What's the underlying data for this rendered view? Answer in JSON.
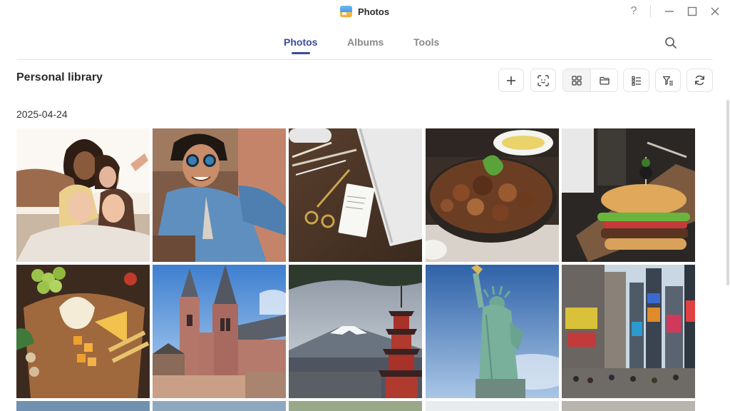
{
  "window": {
    "title": "Photos",
    "controls": [
      "help-icon",
      "minimize-icon",
      "maximize-icon",
      "close-icon"
    ],
    "help_label": "?"
  },
  "tabs": [
    {
      "label": "Photos",
      "active": true
    },
    {
      "label": "Albums",
      "active": false
    },
    {
      "label": "Tools",
      "active": false
    }
  ],
  "header": {
    "title": "Personal library",
    "toolbar": [
      "plus-icon",
      "face-scan-icon",
      "grid-view-icon",
      "folder-view-icon",
      "list-options-icon",
      "filter-icon",
      "refresh-icon"
    ]
  },
  "section": {
    "date": "2025-04-24"
  },
  "photos": [
    {
      "subject": "friends-selfie",
      "icon": "photo-group-selfie"
    },
    {
      "subject": "man-sunglasses-selfie",
      "icon": "photo-man-selfie"
    },
    {
      "subject": "desk-scissors-notes",
      "icon": "photo-desk"
    },
    {
      "subject": "stir-fried-meat-dish",
      "icon": "photo-food-plate"
    },
    {
      "subject": "hamburger",
      "icon": "photo-burger"
    },
    {
      "subject": "cheese-board",
      "icon": "photo-cheese-board"
    },
    {
      "subject": "gothic-cathedral",
      "icon": "photo-cathedral"
    },
    {
      "subject": "mount-fuji-pagoda",
      "icon": "photo-fuji"
    },
    {
      "subject": "statue-of-liberty",
      "icon": "photo-liberty"
    },
    {
      "subject": "times-square",
      "icon": "photo-city-street"
    }
  ],
  "colors": {
    "accent": "#3d4a9e",
    "tab_inactive": "#8a8a8a",
    "border": "#e4e4e4"
  }
}
